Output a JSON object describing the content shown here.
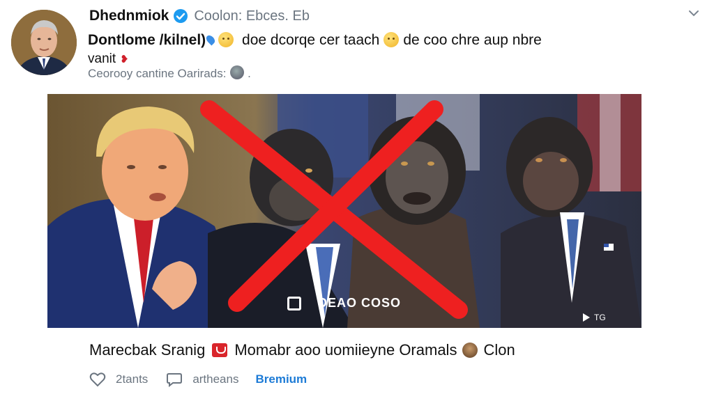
{
  "post": {
    "author_name": "Dhednmiok",
    "handle": "Coolon: Ebces. Eb",
    "line1_bold": "Dontlome /kilnel)",
    "line1_text": "doe dcorqe cer taach",
    "line1_tail": "de coo chre aup nbre",
    "line2": "vanit",
    "line3": "Ceorooy cantine Oarirads:"
  },
  "media": {
    "caption": "DEAO COSO",
    "tag": "TG"
  },
  "caption_row": {
    "label": "Marecbak Sranig",
    "text": "Momabr aoo uomiieyne Oramals",
    "tail": "Clon"
  },
  "actions": {
    "like_label": "2tants",
    "comment_label": "artheans",
    "premium_label": "Bremium"
  },
  "colors": {
    "accent": "#1d7bd6",
    "cross": "#ee2020",
    "verified": "#1d9bf0"
  }
}
